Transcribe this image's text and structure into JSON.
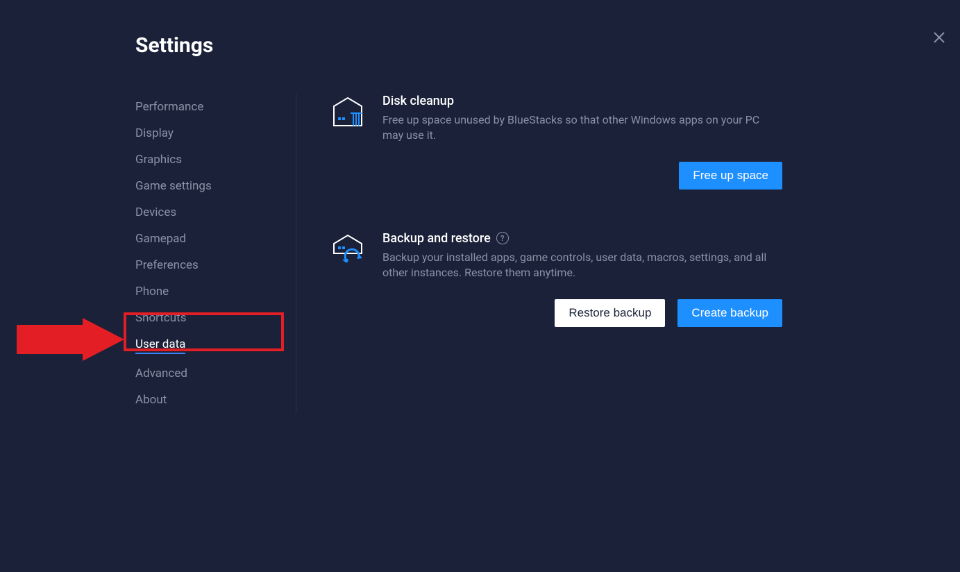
{
  "page": {
    "title": "Settings"
  },
  "sidebar": {
    "items": [
      {
        "label": "Performance",
        "active": false
      },
      {
        "label": "Display",
        "active": false
      },
      {
        "label": "Graphics",
        "active": false
      },
      {
        "label": "Game settings",
        "active": false
      },
      {
        "label": "Devices",
        "active": false
      },
      {
        "label": "Gamepad",
        "active": false
      },
      {
        "label": "Preferences",
        "active": false
      },
      {
        "label": "Phone",
        "active": false
      },
      {
        "label": "Shortcuts",
        "active": false
      },
      {
        "label": "User data",
        "active": true
      },
      {
        "label": "Advanced",
        "active": false
      },
      {
        "label": "About",
        "active": false
      }
    ]
  },
  "disk_cleanup": {
    "title": "Disk cleanup",
    "description": "Free up space unused by BlueStacks so that other Windows apps on your PC may use it.",
    "button": "Free up space"
  },
  "backup_restore": {
    "title": "Backup and restore",
    "description": "Backup your installed apps, game controls, user data, macros, settings, and all other instances. Restore them anytime.",
    "restore_button": "Restore backup",
    "create_button": "Create backup"
  },
  "annotation": {
    "highlighted_item": "User data"
  }
}
